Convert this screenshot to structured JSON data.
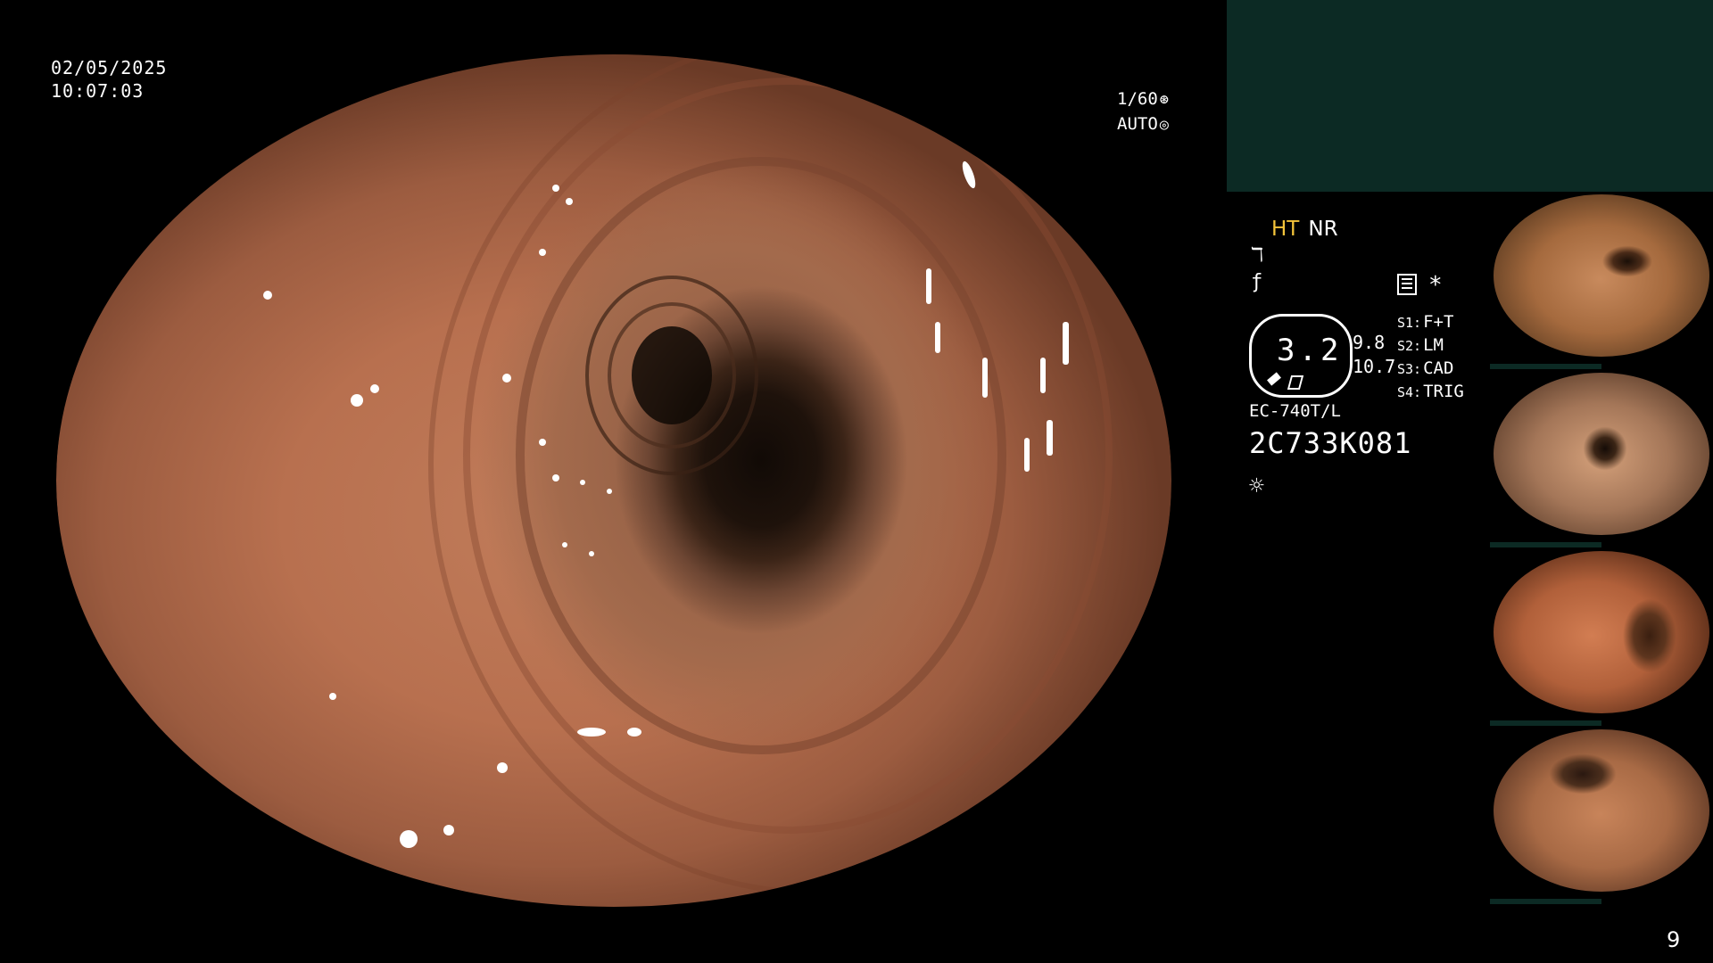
{
  "overlay": {
    "date": "02/05/2025",
    "time": "10:07:03",
    "shutter": "1/60",
    "exposure": "AUTO"
  },
  "panel": {
    "mode_ht": "HT",
    "mode_nr": "NR",
    "gauge_value": "3.2",
    "gauge_right_1": "9.8",
    "gauge_right_2": "10.7",
    "slots": [
      {
        "key": "S1:",
        "value": "F+T"
      },
      {
        "key": "S2:",
        "value": "LM"
      },
      {
        "key": "S3:",
        "value": "CAD"
      },
      {
        "key": "S4:",
        "value": "TRIG"
      }
    ],
    "scope_model": "EC-740T/L",
    "scope_serial": "2C733K081"
  },
  "page_number": "9",
  "icons": {
    "shutter": "aperture-icon",
    "exposure": "iris-icon",
    "icon_a": "curve-icon",
    "icon_b": "slash-f-icon",
    "doc": "document-icon",
    "light": "light-icon"
  },
  "colors": {
    "accent_ht": "#f3c33a",
    "teal_panel": "#0c2a24"
  }
}
